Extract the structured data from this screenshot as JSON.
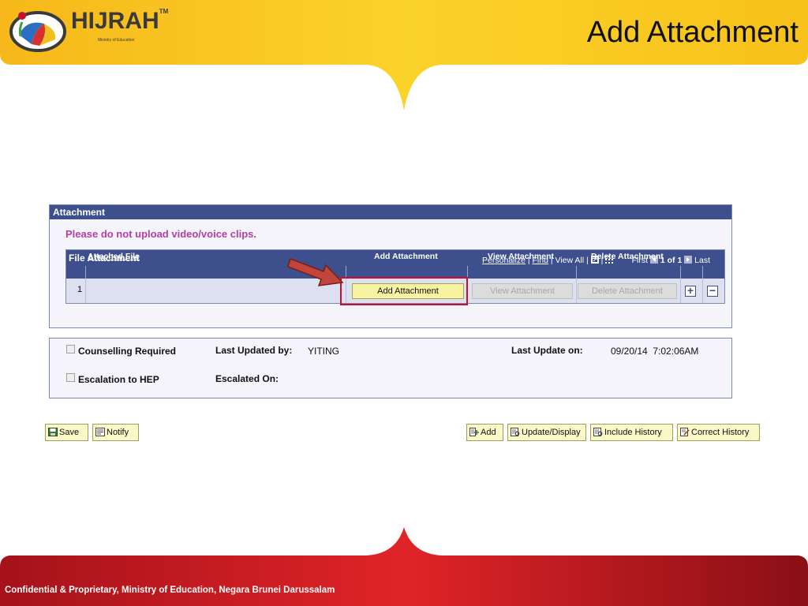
{
  "slide": {
    "title": "Add Attachment",
    "logo_text": "HIJRAH",
    "logo_tm": "TM",
    "logo_subtitle": "Ministry of Education",
    "footer": "Confidential & Proprietary, Ministry of Education, Negara Brunei Darussalam"
  },
  "colors": {
    "header_yellow": "#f7c21a",
    "footer_red": "#b3151c",
    "panel_blue": "#3d4f8d",
    "warning_magenta": "#b040a8",
    "highlight_red": "#c8102e"
  },
  "attachment": {
    "panel_title": "Attachment",
    "warning": "Please do not upload video/voice clips.",
    "grid": {
      "title": "File Attachment",
      "personalize": "Personalize",
      "find": "Find",
      "view_all": "View All",
      "first": "First",
      "count": "1 of 1",
      "last": "Last",
      "columns": {
        "attached_file": "Attached File",
        "add_attachment": "Add Attachment",
        "view_attachment": "View Attachment",
        "delete_attachment": "Delete Attachment"
      },
      "row": {
        "number": "1",
        "attached_file": "",
        "add_label": "Add Attachment",
        "view_label": "View Attachment",
        "delete_label": "Delete Attachment",
        "add_row": "+",
        "delete_row": "−"
      }
    }
  },
  "info": {
    "counselling_label": "Counselling Required",
    "counselling_checked": false,
    "escalation_label": "Escalation to HEP",
    "escalation_checked": false,
    "last_updated_by_label": "Last Updated by:",
    "last_updated_by_value": "YITING",
    "last_update_on_label": "Last Update on:",
    "last_update_on_value": "09/20/14  7:02:06AM",
    "escalated_on_label": "Escalated On:",
    "escalated_on_value": ""
  },
  "toolbar": {
    "save": "Save",
    "notify": "Notify",
    "add": "Add",
    "update_display": "Update/Display",
    "include_history": "Include History",
    "correct_history": "Correct History"
  }
}
